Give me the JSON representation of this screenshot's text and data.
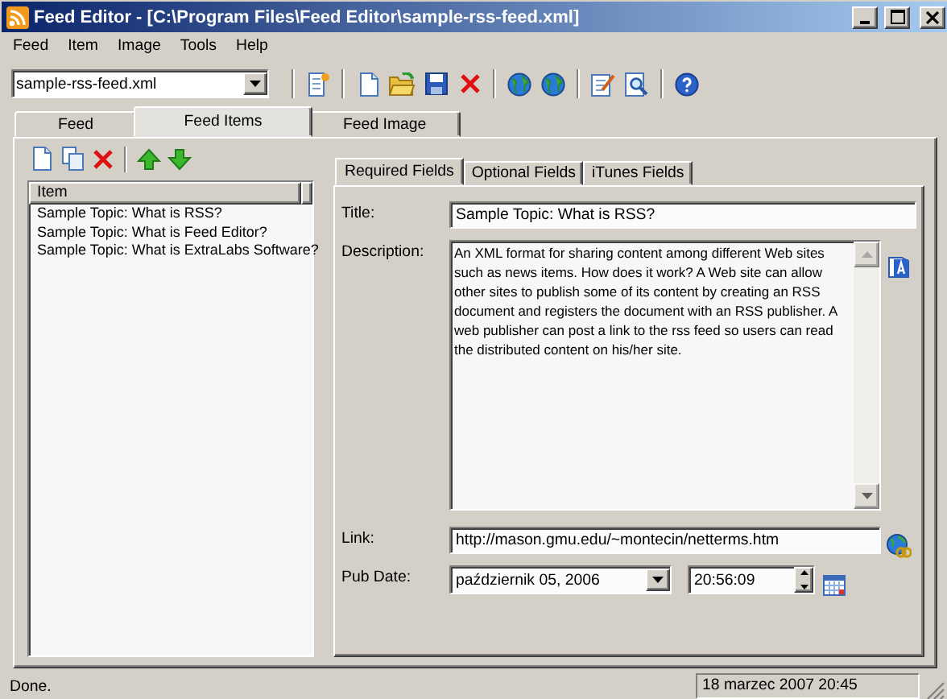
{
  "window": {
    "title": "Feed Editor - [C:\\Program Files\\Feed Editor\\sample-rss-feed.xml]"
  },
  "menu": [
    "Feed",
    "Item",
    "Image",
    "Tools",
    "Help"
  ],
  "toolbar": {
    "file_combo": {
      "value": "sample-rss-feed.xml"
    }
  },
  "tabs": [
    {
      "label": "Feed",
      "selected": false
    },
    {
      "label": "Feed Items",
      "selected": true
    },
    {
      "label": "Feed Image",
      "selected": false
    }
  ],
  "items": {
    "column": "Item",
    "rows": [
      "Sample Topic: What is RSS?",
      "Sample Topic: What is Feed Editor?",
      "Sample Topic: What is ExtraLabs Software?"
    ]
  },
  "detail_tabs": [
    {
      "label": "Required Fields",
      "selected": true
    },
    {
      "label": "Optional Fields",
      "selected": false
    },
    {
      "label": "iTunes Fields",
      "selected": false
    }
  ],
  "form": {
    "title": {
      "label": "Title:",
      "value": "Sample Topic: What is RSS?"
    },
    "description": {
      "label": "Description:",
      "value": "An XML format for sharing content among different Web sites such as news items. How does it work? A Web site can allow other sites to publish some of its content by creating an RSS document and registers the document with an RSS publisher. A web publisher can post a link to the rss feed so users can read the distributed content on his/her site."
    },
    "link": {
      "label": "Link:",
      "value": "http://mason.gmu.edu/~montecin/netterms.htm"
    },
    "pub_date": {
      "label": "Pub Date:",
      "date": "październik 05, 2006",
      "time": "20:56:09"
    }
  },
  "status_bar": {
    "message": "Done.",
    "datetime": "18 marzec 2007 20:45"
  }
}
